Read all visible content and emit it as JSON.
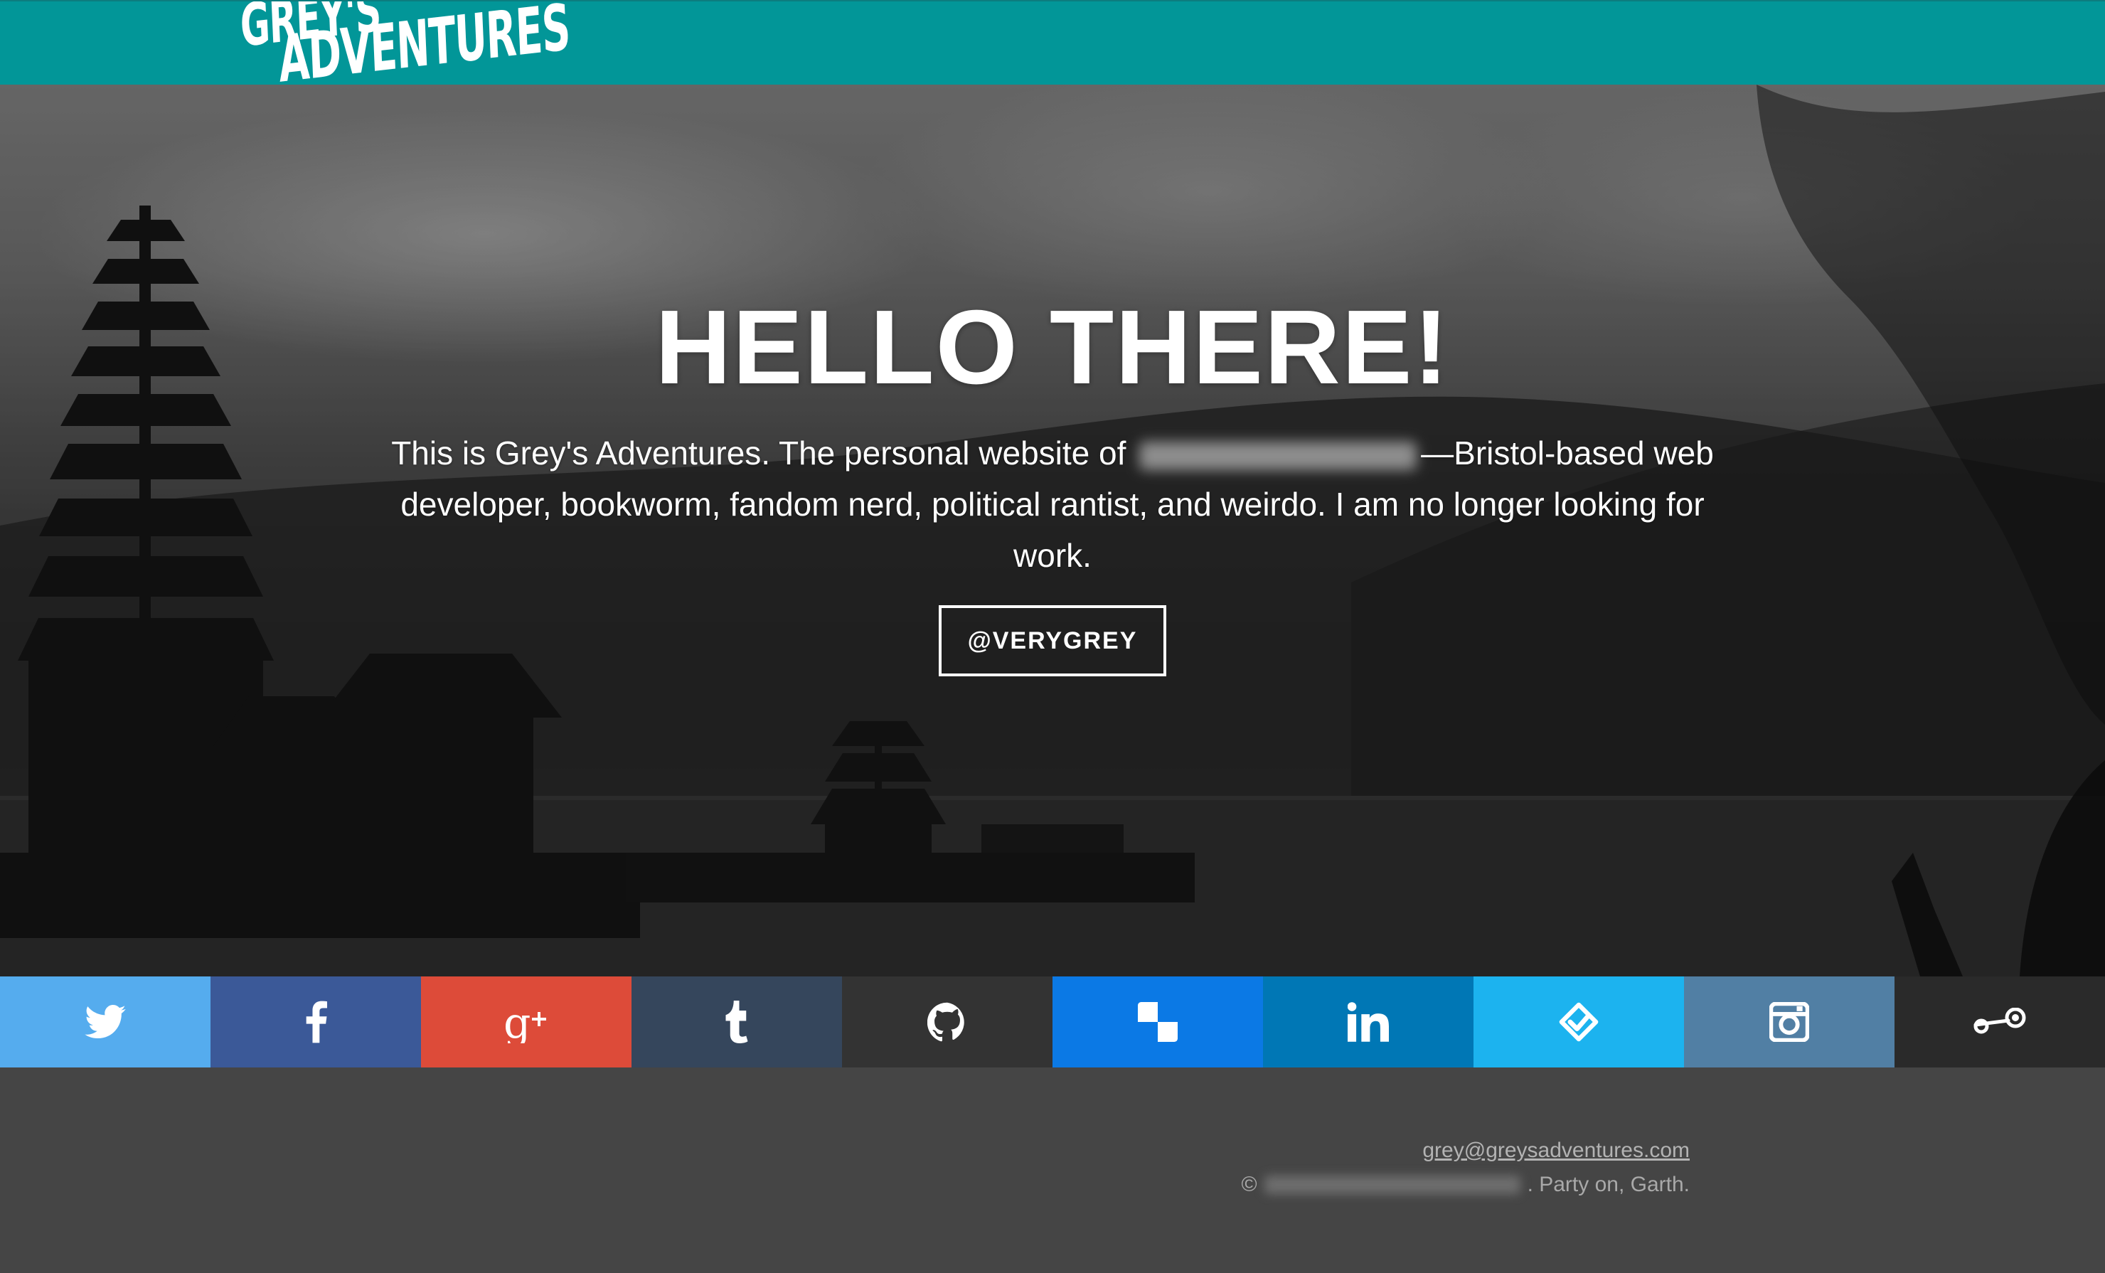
{
  "header": {
    "logo_line1": "GREY'S",
    "logo_line2": "ADVENTURES",
    "bar_color": "#029698"
  },
  "hero": {
    "title": "HELLO THERE!",
    "intro_before": "This is Grey's Adventures. The personal website of",
    "intro_after": "—Bristol-based web developer, bookworm, fandom nerd, political rantist, and weirdo. I am no longer looking for work.",
    "button_label": "@VERYGREY"
  },
  "social": [
    {
      "name": "twitter",
      "icon": "twitter-icon",
      "color": "#55acee"
    },
    {
      "name": "facebook",
      "icon": "facebook-icon",
      "color": "#3b5998"
    },
    {
      "name": "google-plus",
      "icon": "google-plus-icon",
      "color": "#dd4b39"
    },
    {
      "name": "tumblr",
      "icon": "tumblr-icon",
      "color": "#35465c"
    },
    {
      "name": "github",
      "icon": "github-icon",
      "color": "#333333"
    },
    {
      "name": "delicious",
      "icon": "delicious-icon",
      "color": "#0b79e5"
    },
    {
      "name": "linkedin",
      "icon": "linkedin-icon",
      "color": "#0077b5"
    },
    {
      "name": "foursquare",
      "icon": "foursquare-icon",
      "color": "#1cb3ef"
    },
    {
      "name": "instagram",
      "icon": "instagram-icon",
      "color": "#517fa4"
    },
    {
      "name": "steam",
      "icon": "steam-icon",
      "color": "#2a2a2a"
    }
  ],
  "footer": {
    "email": "grey@greysadventures.com",
    "copyright_symbol": "©",
    "copyright_tail": ". Party on, Garth."
  }
}
